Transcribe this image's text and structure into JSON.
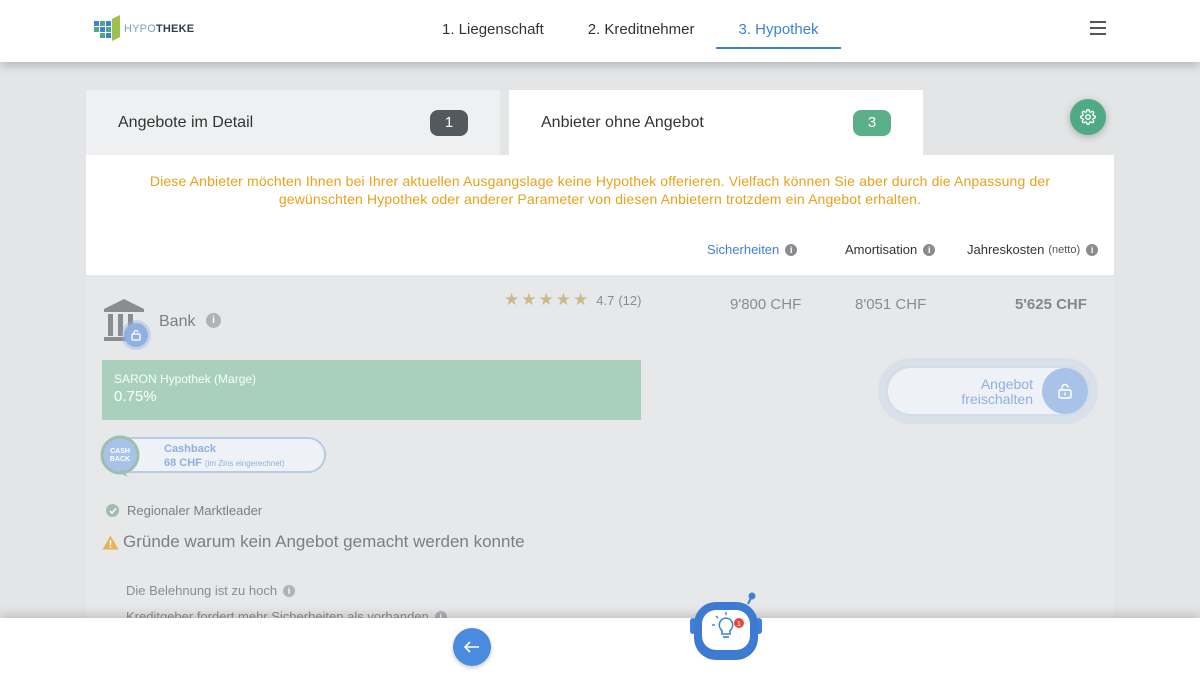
{
  "header": {
    "logo": {
      "prefix": "HYPO",
      "suffix": "THEKE"
    },
    "steps": [
      {
        "label": "1. Liegenschaft"
      },
      {
        "label": "2. Kreditnehmer"
      },
      {
        "label": "3. Hypothek"
      }
    ],
    "active_step": 2
  },
  "tabs": [
    {
      "label": "Angebote im Detail",
      "count": "1"
    },
    {
      "label": "Anbieter ohne Angebot",
      "count": "3"
    }
  ],
  "notice": "Diese Anbieter möchten Ihnen bei Ihrer aktuellen Ausgangslage keine Hypothek offerieren. Vielfach können Sie aber durch die Anpassung der gewünschten Hypothek oder anderer Parameter von diesen Anbietern trotzdem ein Angebot erhalten.",
  "columns": {
    "sicherheiten": "Sicherheiten",
    "amortisation": "Amortisation",
    "jahreskosten": "Jahreskosten",
    "jahreskosten_note": "(netto)"
  },
  "offer": {
    "bank_name": "Bank",
    "rating": "4.7",
    "reviews": "(12)",
    "stars": 5,
    "sicherheiten_value": "9'800 CHF",
    "amortisation_value": "8'051 CHF",
    "jahreskosten_value": "5'625 CHF",
    "rate_label": "SARON Hypothek (Marge)",
    "rate_value": "0.75%",
    "unlock_line1": "Angebot",
    "unlock_line2": "freischalten",
    "cashback_icon_line1": "CASH",
    "cashback_icon_line2": "BACK",
    "cashback_title": "Cashback",
    "cashback_amount": "68 CHF",
    "cashback_note": "(im Zins eingerechnet)",
    "feature": "Regionaler Marktleader",
    "reasons_title": "Gründe warum kein Angebot gemacht werden konnte",
    "reasons": [
      "Die Belehnung ist zu hoch",
      "Kreditgeber fordert mehr Sicherheiten als vorhanden"
    ]
  },
  "assistant": {
    "notification_count": "1"
  },
  "colors": {
    "primary": "#3d82d6",
    "green": "#5bb08a",
    "notice": "#e8a21a",
    "rate_box": "#a9d0bd"
  }
}
